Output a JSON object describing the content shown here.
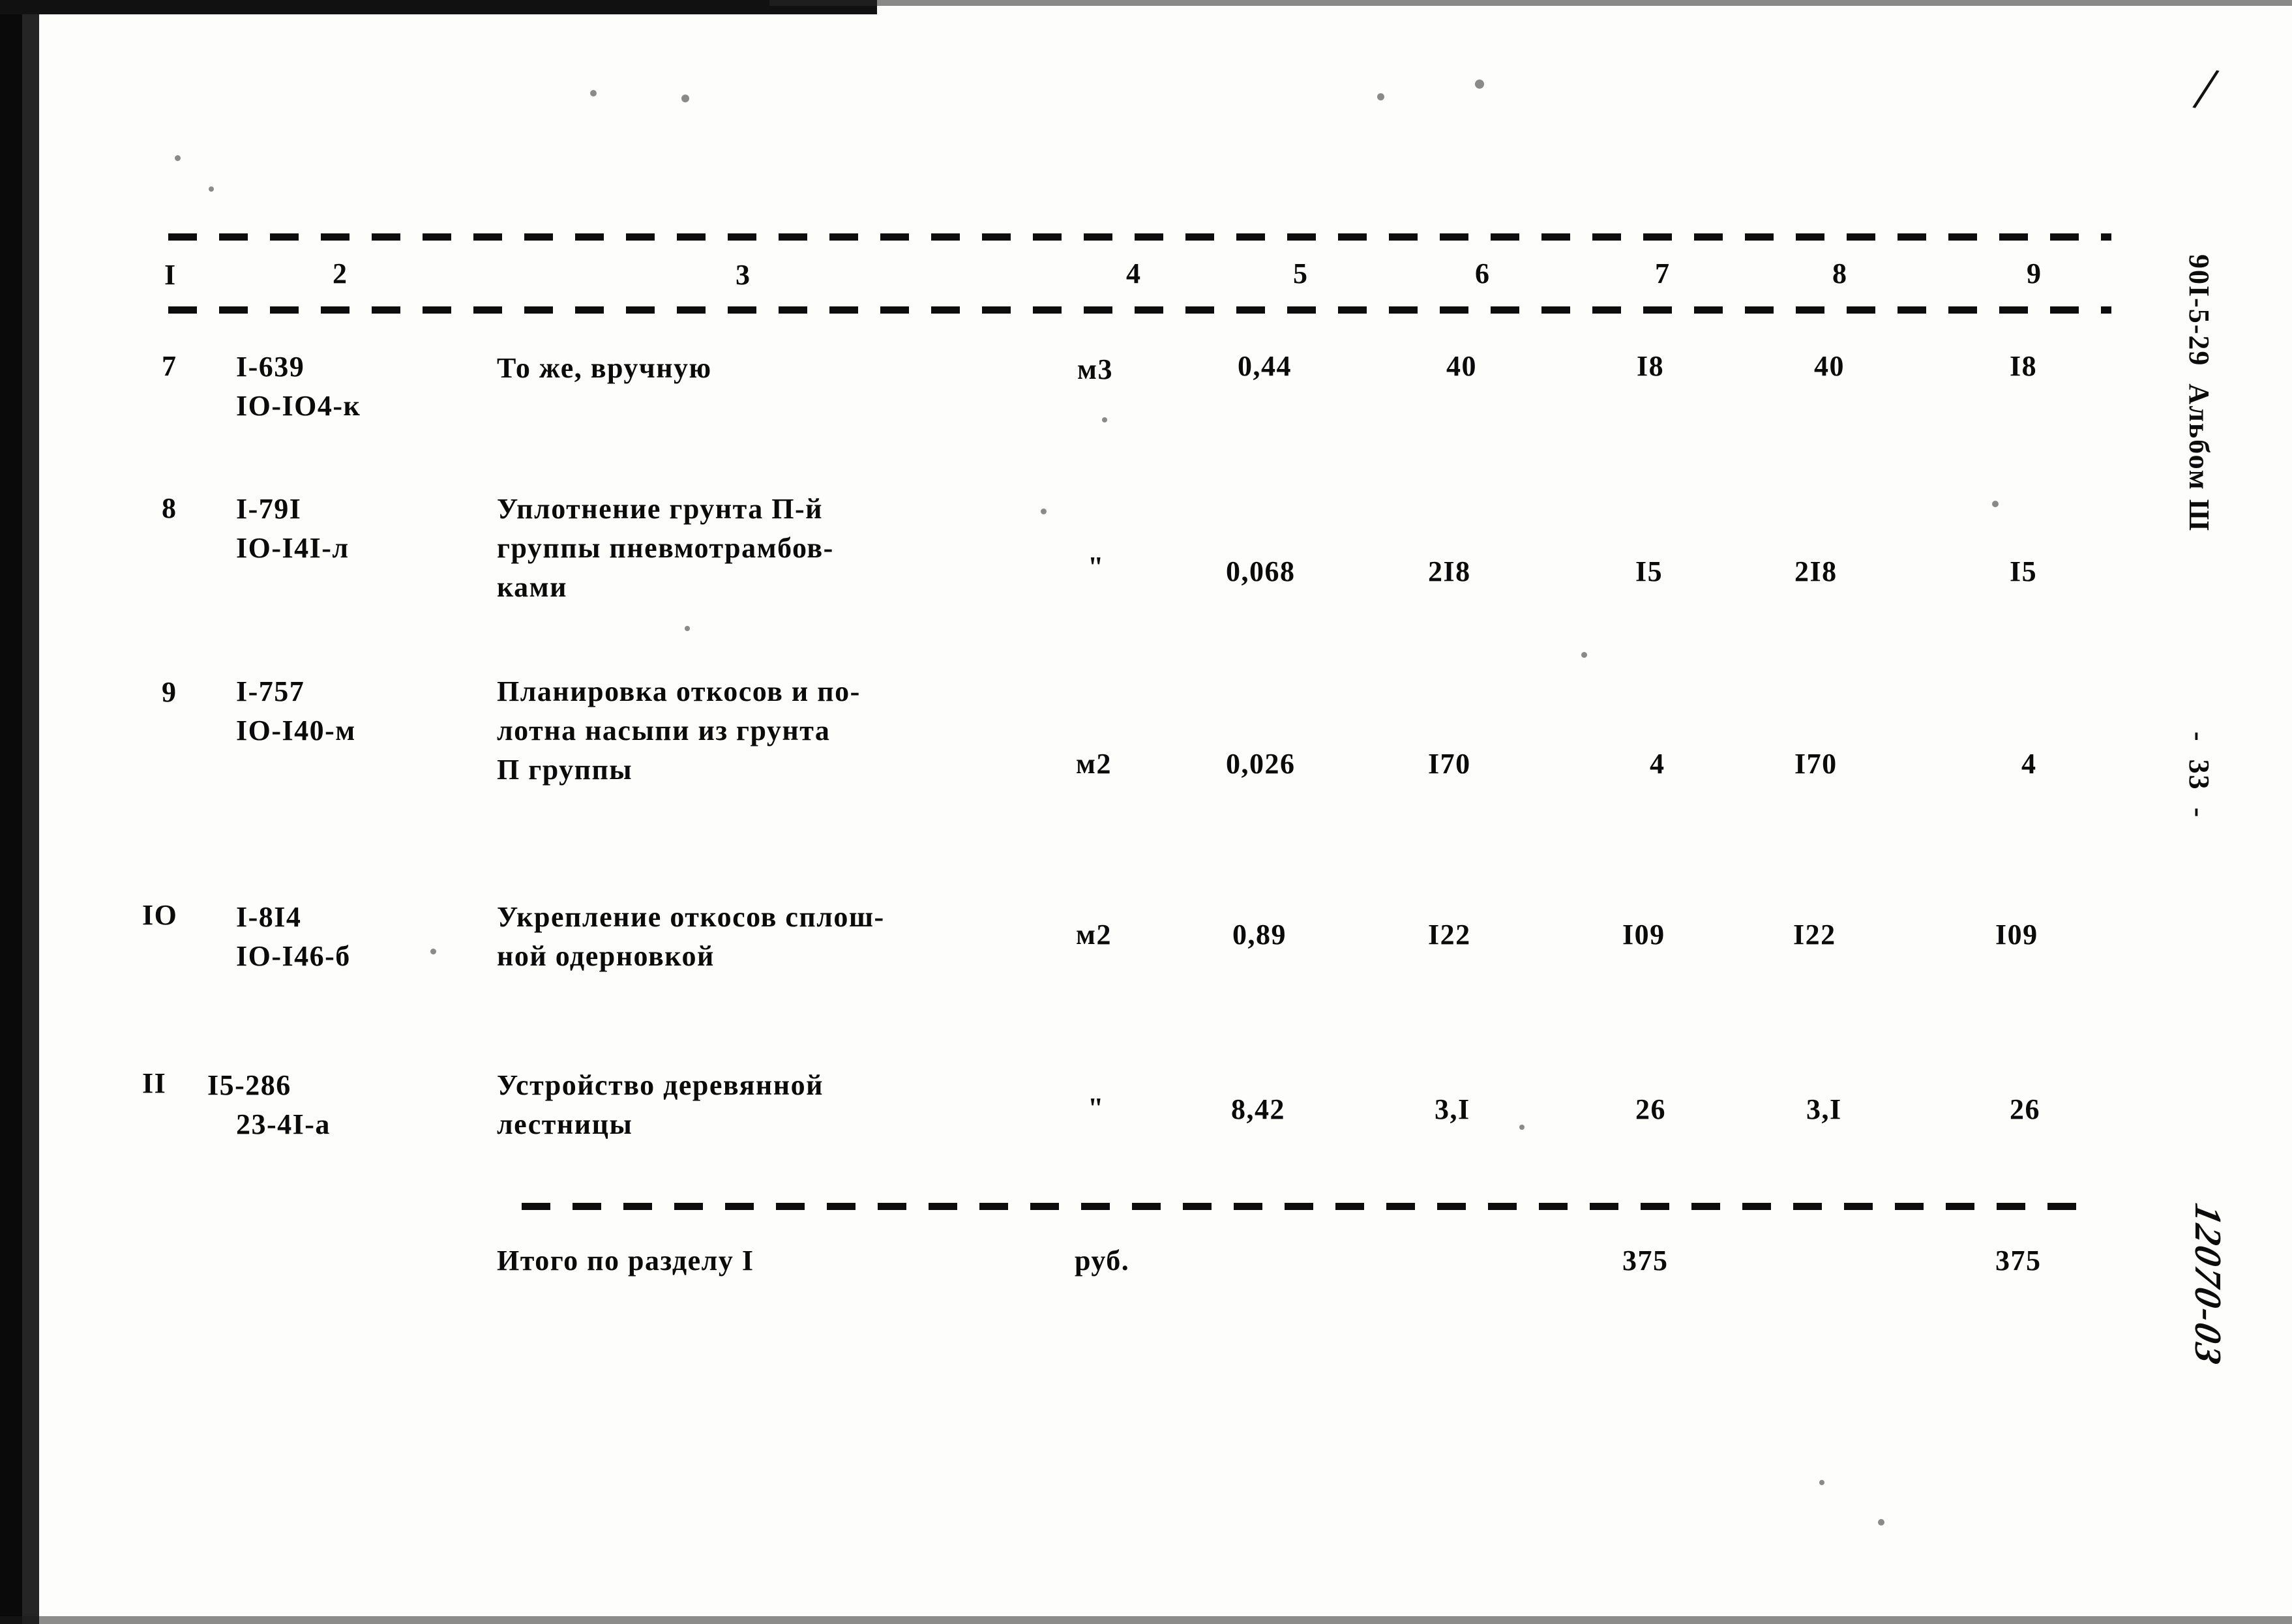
{
  "page": {
    "sheet_corner_mark": "/",
    "side_label": "90I-5-29  Альбом Ш",
    "page_number_label": "-  33  -",
    "handwritten_code": "12070-03"
  },
  "table": {
    "column_headers": [
      "I",
      "2",
      "3",
      "4",
      "5",
      "6",
      "7",
      "8",
      "9"
    ],
    "rows": [
      {
        "num": "7",
        "codes": [
          "I-639",
          "IO-IO4-к"
        ],
        "description": [
          "То же, вручную"
        ],
        "unit": "м3",
        "c5": "0,44",
        "c6": "40",
        "c7": "I8",
        "c8": "40",
        "c9": "I8"
      },
      {
        "num": "8",
        "codes": [
          "I-79I",
          "IO-I4I-л"
        ],
        "description": [
          "Уплотнение грунта П-й",
          "группы пневмотрамбов-",
          "ками"
        ],
        "unit": "\"",
        "c5": "0,068",
        "c6": "2I8",
        "c7": "I5",
        "c8": "2I8",
        "c9": "I5"
      },
      {
        "num": "9",
        "codes": [
          "I-757",
          "IO-I40-м"
        ],
        "description": [
          "Планировка откосов и по-",
          "лотна насыпи из грунта",
          "П группы"
        ],
        "unit": "м2",
        "c5": "0,026",
        "c6": "I70",
        "c7": "4",
        "c8": "I70",
        "c9": "4"
      },
      {
        "num": "IO",
        "codes": [
          "I-8I4",
          "IO-I46-б"
        ],
        "description": [
          "Укрепление откосов сплош-",
          "ной одерновкой"
        ],
        "unit": "м2",
        "c5": "0,89",
        "c6": "I22",
        "c7": "I09",
        "c8": "I22",
        "c9": "I09"
      },
      {
        "num": "II",
        "codes": [
          "I5-286",
          "23-4I-а"
        ],
        "description": [
          "Устройство деревянной",
          "лестницы"
        ],
        "unit": "\"",
        "c5": "8,42",
        "c6": "3,I",
        "c7": "26",
        "c8": "3,I",
        "c9": "26"
      }
    ],
    "total": {
      "label": "Итого по разделу I",
      "unit": "руб.",
      "c5": "",
      "c6": "",
      "c7": "375",
      "c8": "",
      "c9": "375"
    }
  }
}
